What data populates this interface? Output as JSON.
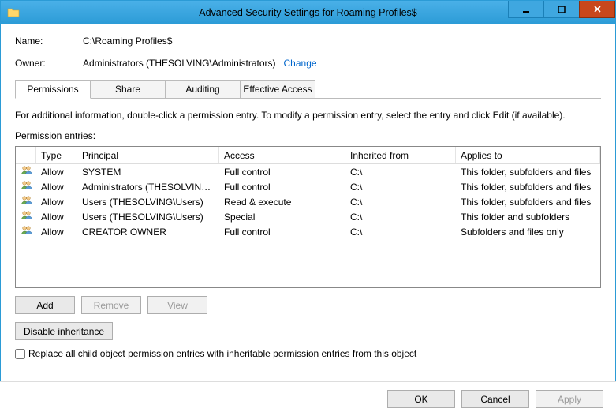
{
  "window": {
    "title": "Advanced Security Settings for Roaming Profiles$"
  },
  "fields": {
    "name_label": "Name:",
    "name_value": "C:\\Roaming Profiles$",
    "owner_label": "Owner:",
    "owner_value": "Administrators (THESOLVING\\Administrators)",
    "change_label": "Change"
  },
  "tabs": {
    "permissions": "Permissions",
    "share": "Share",
    "auditing": "Auditing",
    "effective": "Effective Access"
  },
  "instruction": "For additional information, double-click a permission entry. To modify a permission entry, select the entry and click Edit (if available).",
  "entries_label": "Permission entries:",
  "columns": {
    "type": "Type",
    "principal": "Principal",
    "access": "Access",
    "inherited": "Inherited from",
    "applies": "Applies to"
  },
  "entries": [
    {
      "type": "Allow",
      "principal": "SYSTEM",
      "access": "Full control",
      "inherited": "C:\\",
      "applies": "This folder, subfolders and files"
    },
    {
      "type": "Allow",
      "principal": "Administrators (THESOLVING...",
      "access": "Full control",
      "inherited": "C:\\",
      "applies": "This folder, subfolders and files"
    },
    {
      "type": "Allow",
      "principal": "Users (THESOLVING\\Users)",
      "access": "Read & execute",
      "inherited": "C:\\",
      "applies": "This folder, subfolders and files"
    },
    {
      "type": "Allow",
      "principal": "Users (THESOLVING\\Users)",
      "access": "Special",
      "inherited": "C:\\",
      "applies": "This folder and subfolders"
    },
    {
      "type": "Allow",
      "principal": "CREATOR OWNER",
      "access": "Full control",
      "inherited": "C:\\",
      "applies": "Subfolders and files only"
    }
  ],
  "buttons": {
    "add": "Add",
    "remove": "Remove",
    "view": "View",
    "disable_inh": "Disable inheritance",
    "ok": "OK",
    "cancel": "Cancel",
    "apply": "Apply"
  },
  "checkbox_label": "Replace all child object permission entries with inheritable permission entries from this object"
}
